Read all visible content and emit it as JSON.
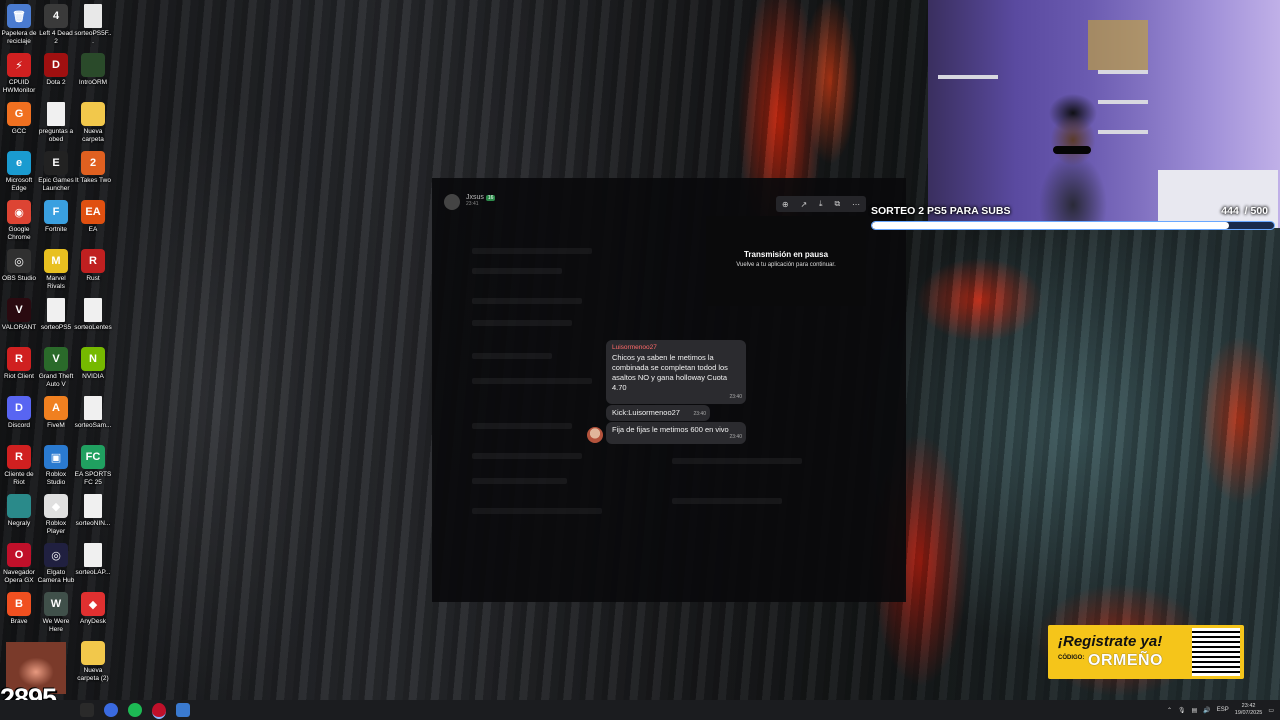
{
  "desktop_icons": [
    {
      "label": "Papelera de reciclaje",
      "color": "#4a7bd0",
      "glyph": "🗑"
    },
    {
      "label": "Left 4 Dead 2",
      "color": "#3a3a3a",
      "glyph": "4"
    },
    {
      "label": "sorteoPS5F...",
      "color": "#e8e8e8",
      "glyph": ""
    },
    {
      "label": "CPUID HWMonitor",
      "color": "#d02020",
      "glyph": "⚡"
    },
    {
      "label": "Dota 2",
      "color": "#a01010",
      "glyph": "D"
    },
    {
      "label": "IntroORM",
      "color": "#2a4a2a",
      "glyph": ""
    },
    {
      "label": "GCC",
      "color": "#f07020",
      "glyph": "G"
    },
    {
      "label": "preguntas a obed",
      "color": "#f0f0f0",
      "glyph": ""
    },
    {
      "label": "Nueva carpeta",
      "color": "#f2c84b",
      "glyph": ""
    },
    {
      "label": "Microsoft Edge",
      "color": "#1a9bd0",
      "glyph": "e"
    },
    {
      "label": "Epic Games Launcher",
      "color": "#222",
      "glyph": "E"
    },
    {
      "label": "It Takes Two",
      "color": "#e06020",
      "glyph": "2"
    },
    {
      "label": "Google Chrome",
      "color": "#dd4433",
      "glyph": "◉"
    },
    {
      "label": "Fortnite",
      "color": "#3aa0e0",
      "glyph": "F"
    },
    {
      "label": "EA",
      "color": "#e05010",
      "glyph": "EA"
    },
    {
      "label": "OBS Studio",
      "color": "#303030",
      "glyph": "◎"
    },
    {
      "label": "Marvel Rivals",
      "color": "#e8c020",
      "glyph": "M"
    },
    {
      "label": "Rust",
      "color": "#c02020",
      "glyph": "R"
    },
    {
      "label": "VALORANT",
      "color": "#2a0a10",
      "glyph": "V"
    },
    {
      "label": "sorteoPS5",
      "color": "#f0f0f0",
      "glyph": ""
    },
    {
      "label": "sorteoLentes",
      "color": "#f0f0f0",
      "glyph": ""
    },
    {
      "label": "Riot Client",
      "color": "#d02020",
      "glyph": "R"
    },
    {
      "label": "Grand Theft Auto V",
      "color": "#2a6a2a",
      "glyph": "V"
    },
    {
      "label": "NVIDIA",
      "color": "#76b900",
      "glyph": "N"
    },
    {
      "label": "Discord",
      "color": "#5865f2",
      "glyph": "D"
    },
    {
      "label": "FiveM",
      "color": "#f08020",
      "glyph": "A"
    },
    {
      "label": "sorteoSam...",
      "color": "#f0f0f0",
      "glyph": ""
    },
    {
      "label": "Cliente de Riot",
      "color": "#d02020",
      "glyph": "R"
    },
    {
      "label": "Roblox Studio",
      "color": "#2a7ad0",
      "glyph": "▣"
    },
    {
      "label": "EA SPORTS FC 25",
      "color": "#20a060",
      "glyph": "FC"
    },
    {
      "label": "Negraly",
      "color": "#2a8a8a",
      "glyph": ""
    },
    {
      "label": "Roblox Player",
      "color": "#e0e0e0",
      "glyph": "◆"
    },
    {
      "label": "sorteoNIN...",
      "color": "#f0f0f0",
      "glyph": ""
    },
    {
      "label": "Navegador Opera GX",
      "color": "#c0102a",
      "glyph": "O"
    },
    {
      "label": "Elgato Camera Hub",
      "color": "#202040",
      "glyph": "◎"
    },
    {
      "label": "sorteoLAP...",
      "color": "#f0f0f0",
      "glyph": ""
    },
    {
      "label": "Brave",
      "color": "#f05020",
      "glyph": "B"
    },
    {
      "label": "We Were Here",
      "color": "#40504a",
      "glyph": "W"
    },
    {
      "label": "AnyDesk",
      "color": "#e03030",
      "glyph": "◆"
    },
    {
      "label": "",
      "color": "transparent",
      "glyph": ""
    },
    {
      "label": "",
      "color": "transparent",
      "glyph": ""
    },
    {
      "label": "Nueva carpeta (2)",
      "color": "#f2c84b",
      "glyph": ""
    }
  ],
  "chat_window": {
    "user": "Jxsus",
    "badge": "16",
    "time": "23:41"
  },
  "player": {
    "toolbar_icons": [
      "zoom-icon",
      "share-icon",
      "download-icon",
      "external-icon",
      "more-icon"
    ],
    "paused_title": "Transmisión en pausa",
    "paused_subtitle": "Vuelve a tu aplicación para continuar."
  },
  "messages": [
    {
      "author": "Luisormenoo27",
      "text": "Chicos ya saben le metimos la combinada se completan todod los asaltos NO y gana holloway Cuota 4.70",
      "time": "23:40"
    },
    {
      "author": "",
      "text": "Kick:Luisormenoo27",
      "time": "23:40"
    },
    {
      "author": "",
      "text": "Fija de fijas le metimos 600 en vivo",
      "time": "23:40"
    }
  ],
  "giveaway": {
    "title": "SORTEO 2 PS5 PARA SUBS",
    "count": "444",
    "total": "/ 500",
    "progress": 0.888
  },
  "promo": {
    "headline": "¡Registrate ya!",
    "code_label": "CÓDIGO:",
    "code": "ORMEÑO"
  },
  "watermark": "2895",
  "taskbar": {
    "lang": "ESP",
    "time": "23:42",
    "date": "19/07/2025"
  }
}
